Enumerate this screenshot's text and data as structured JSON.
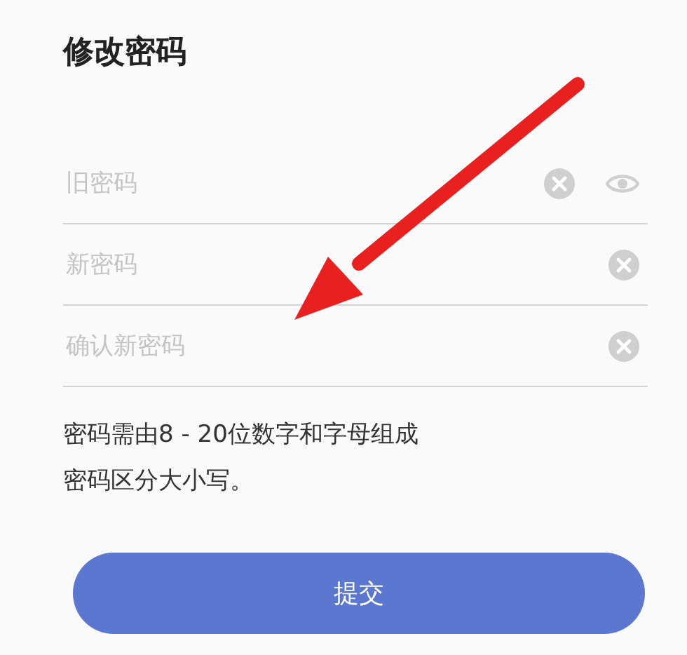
{
  "title": "修改密码",
  "fields": [
    {
      "placeholder": "旧密码",
      "show_toggle": true
    },
    {
      "placeholder": "新密码",
      "show_toggle": false
    },
    {
      "placeholder": "确认新密码",
      "show_toggle": false
    }
  ],
  "hint_lines": [
    "密码需由8 - 20位数字和字母组成",
    "密码区分大小写。"
  ],
  "submit": "提交",
  "annotation": {
    "kind": "arrow"
  }
}
